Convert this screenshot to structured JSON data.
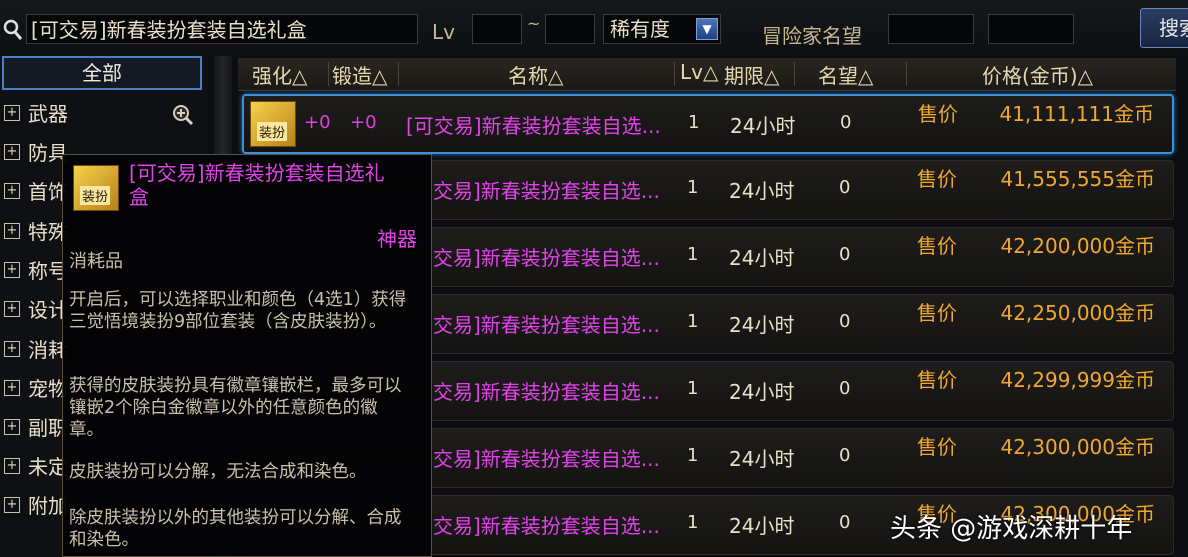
{
  "search": {
    "value": "[可交易]新春装扮套装自选礼盒"
  },
  "filters": {
    "lv_label": "Lv",
    "lv_separator": "~",
    "rarity_label": "稀有度",
    "fame_label": "冒险家名望",
    "search_button": "搜索"
  },
  "categories": {
    "all": "全部",
    "items": [
      {
        "label": "武器"
      },
      {
        "label": "防具"
      },
      {
        "label": "首饰"
      },
      {
        "label": "特殊"
      },
      {
        "label": "称号"
      },
      {
        "label": "设计"
      },
      {
        "label": "消耗"
      },
      {
        "label": "宠物"
      },
      {
        "label": "副职"
      },
      {
        "label": "未定"
      },
      {
        "label": "附加"
      }
    ]
  },
  "table": {
    "headers": [
      "强化△",
      "锻造△",
      "名称△",
      "Lv△",
      "期限△",
      "名望△",
      "价格(金币)△"
    ],
    "rows": [
      {
        "strength": "+0",
        "forge": "+0",
        "name": "[可交易]新春装扮套装自选...",
        "lv": "1",
        "period": "24小时",
        "fame": "0",
        "price_label": "售价",
        "price": "41,111,111金币"
      },
      {
        "name": "交易]新春装扮套装自选...",
        "lv": "1",
        "period": "24小时",
        "fame": "0",
        "price_label": "售价",
        "price": "41,555,555金币"
      },
      {
        "name": "交易]新春装扮套装自选...",
        "lv": "1",
        "period": "24小时",
        "fame": "0",
        "price_label": "售价",
        "price": "42,200,000金币"
      },
      {
        "name": "交易]新春装扮套装自选...",
        "lv": "1",
        "period": "24小时",
        "fame": "0",
        "price_label": "售价",
        "price": "42,250,000金币"
      },
      {
        "name": "交易]新春装扮套装自选...",
        "lv": "1",
        "period": "24小时",
        "fame": "0",
        "price_label": "售价",
        "price": "42,299,999金币"
      },
      {
        "name": "交易]新春装扮套装自选...",
        "lv": "1",
        "period": "24小时",
        "fame": "0",
        "price_label": "售价",
        "price": "42,300,000金币"
      },
      {
        "name": "交易]新春装扮套装自选...",
        "lv": "1",
        "period": "24小时",
        "fame": "0",
        "price_label": "售价",
        "price": "42,300,000金币"
      }
    ]
  },
  "tooltip": {
    "icon_tag": "装扮",
    "title": "[可交易]新春装扮套装自选礼盒",
    "rarity": "神器",
    "type": "消耗品",
    "desc1": "开启后，可以选择职业和颜色（4选1）获得三觉悟境装扮9部位套装（含皮肤装扮）。",
    "desc2": "获得的皮肤装扮具有徽章镶嵌栏，最多可以镶嵌2个除白金徽章以外的任意颜色的徽章。",
    "desc3": "皮肤装扮可以分解，无法合成和染色。",
    "desc4": "除皮肤装扮以外的其他装扮可以分解、合成和染色。"
  },
  "watermark": "头条 @游戏深耕十年",
  "colors": {
    "accent_blue": "#3e8fd6",
    "name_magenta": "#e044e8",
    "price_gold": "#f0a830"
  },
  "icons": [
    "search-icon",
    "dropdown-arrow-icon",
    "plus-box-icon",
    "zoom-in-icon",
    "item-icon"
  ]
}
